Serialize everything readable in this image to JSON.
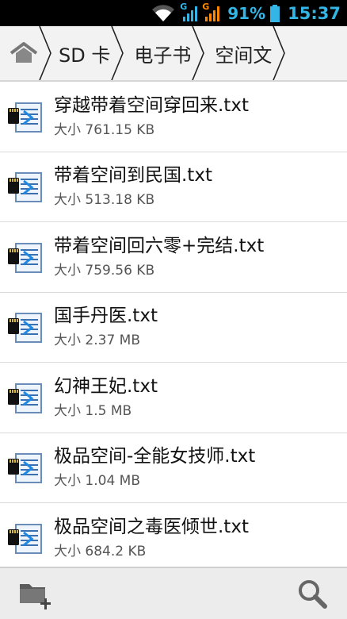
{
  "status_bar": {
    "signal_1_label": "G",
    "signal_2_label": "G",
    "battery_percent": "91%",
    "time": "15:37",
    "accent_color": "#33b5e5",
    "signal_2_color": "#ff8800"
  },
  "breadcrumb": {
    "home_icon": "home-icon",
    "items": [
      {
        "label": "SD 卡"
      },
      {
        "label": "电子书"
      },
      {
        "label": "空间文"
      }
    ]
  },
  "files": [
    {
      "name": "穿越带着空间穿回来.txt",
      "size": "大小 761.15 KB"
    },
    {
      "name": "带着空间到民国.txt",
      "size": "大小 513.18 KB"
    },
    {
      "name": "带着空间回六零+完结.txt",
      "size": "大小 759.56 KB"
    },
    {
      "name": "国手丹医.txt",
      "size": "大小 2.37 MB"
    },
    {
      "name": "幻神王妃.txt",
      "size": "大小 1.5 MB"
    },
    {
      "name": "极品空间-全能女技师.txt",
      "size": "大小 1.04 MB"
    },
    {
      "name": "极品空间之毒医倾世.txt",
      "size": "大小 684.2 KB"
    }
  ],
  "toolbar": {
    "new_folder_icon": "new-folder-icon",
    "search_icon": "search-icon"
  }
}
